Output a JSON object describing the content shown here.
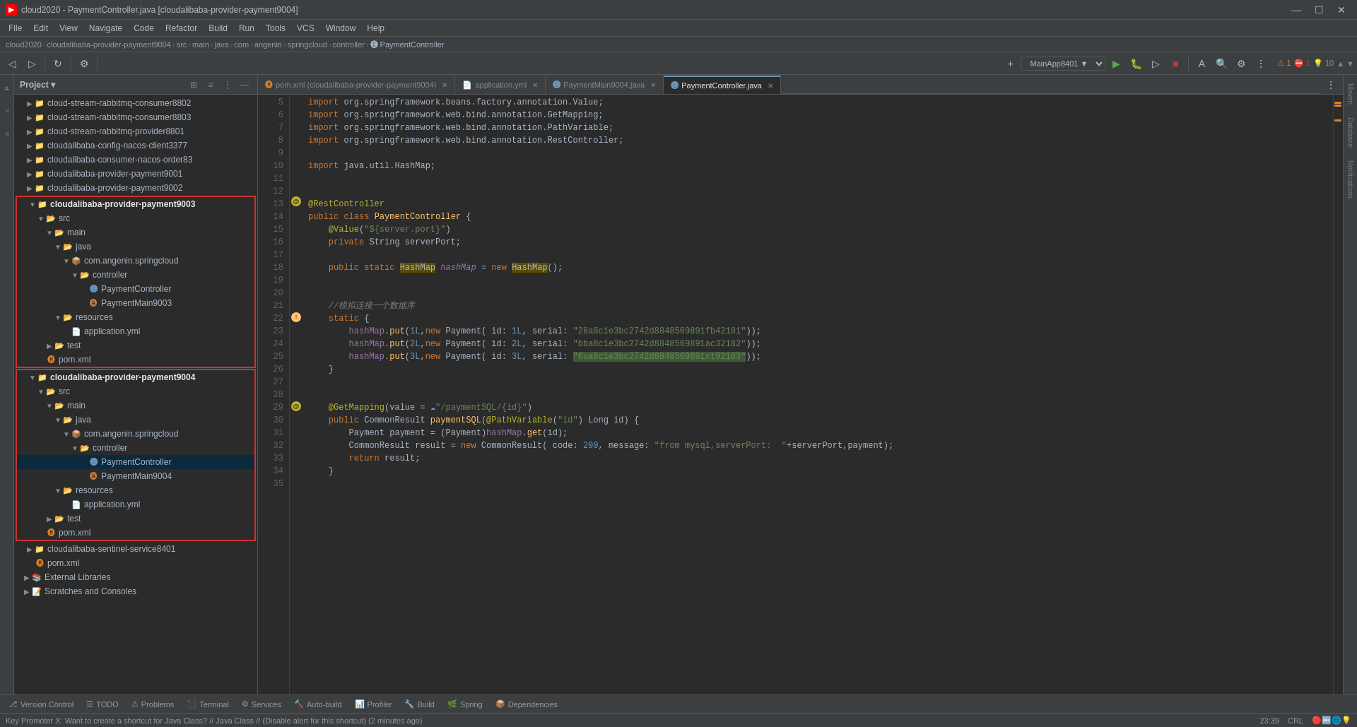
{
  "titleBar": {
    "title": "cloud2020 - PaymentController.java [cloudalibaba-provider-payment9004]",
    "winButtons": [
      "—",
      "☐",
      "✕"
    ]
  },
  "menuBar": {
    "items": [
      "File",
      "Edit",
      "View",
      "Navigate",
      "Code",
      "Refactor",
      "Build",
      "Run",
      "Tools",
      "VCS",
      "Window",
      "Help"
    ]
  },
  "breadcrumb": {
    "items": [
      "cloud2020",
      "cloudalibaba-provider-payment9004",
      "src",
      "main",
      "java",
      "com",
      "angenin",
      "springcloud",
      "controller",
      "PaymentController"
    ]
  },
  "projectPanel": {
    "title": "Project",
    "treeItems": [
      {
        "id": "cloud-stream-rabbitmq-consumer8802",
        "label": "cloud-stream-rabbitmq-consumer8802",
        "level": 1,
        "type": "module",
        "collapsed": true
      },
      {
        "id": "cloud-stream-rabbitmq-consumer8803",
        "label": "cloud-stream-rabbitmq-consumer8803",
        "level": 1,
        "type": "module",
        "collapsed": true
      },
      {
        "id": "cloud-stream-rabbitmq-provider8801",
        "label": "cloud-stream-rabbitmq-provider8801",
        "level": 1,
        "type": "module",
        "collapsed": true
      },
      {
        "id": "cloudalibaba-config-nacos-client3377",
        "label": "cloudalibaba-config-nacos-client3377",
        "level": 1,
        "type": "module",
        "collapsed": true
      },
      {
        "id": "cloudalibaba-consumer-nacos-order83",
        "label": "cloudalibaba-consumer-nacos-order83",
        "level": 1,
        "type": "module",
        "collapsed": true
      },
      {
        "id": "cloudalibaba-provider-payment9001",
        "label": "cloudalibaba-provider-payment9001",
        "level": 1,
        "type": "module",
        "collapsed": true
      },
      {
        "id": "cloudalibaba-provider-payment9002",
        "label": "cloudalibaba-provider-payment9002",
        "level": 1,
        "type": "module",
        "collapsed": true
      },
      {
        "id": "cloudalibaba-provider-payment9003",
        "label": "cloudalibaba-provider-payment9003",
        "level": 1,
        "type": "module",
        "highlighted": true,
        "collapsed": false
      },
      {
        "id": "src-9003",
        "label": "src",
        "level": 2,
        "type": "folder",
        "collapsed": false
      },
      {
        "id": "main-9003",
        "label": "main",
        "level": 3,
        "type": "folder",
        "collapsed": false
      },
      {
        "id": "java-9003",
        "label": "java",
        "level": 4,
        "type": "folder",
        "collapsed": false
      },
      {
        "id": "com-9003",
        "label": "com.angenin.springcloud",
        "level": 5,
        "type": "package",
        "collapsed": false
      },
      {
        "id": "controller-9003",
        "label": "controller",
        "level": 6,
        "type": "folder",
        "collapsed": false
      },
      {
        "id": "PaymentController-9003",
        "label": "PaymentController",
        "level": 7,
        "type": "java-class"
      },
      {
        "id": "PaymentMain9003",
        "label": "PaymentMain9003",
        "level": 7,
        "type": "java-app"
      },
      {
        "id": "resources-9003",
        "label": "resources",
        "level": 4,
        "type": "folder",
        "collapsed": false
      },
      {
        "id": "application-9003",
        "label": "application.yml",
        "level": 5,
        "type": "yml"
      },
      {
        "id": "test-9003",
        "label": "test",
        "level": 3,
        "type": "folder",
        "collapsed": true
      },
      {
        "id": "pom-9003",
        "label": "pom.xml",
        "level": 2,
        "type": "xml"
      },
      {
        "id": "cloudalibaba-provider-payment9004",
        "label": "cloudalibaba-provider-payment9004",
        "level": 1,
        "type": "module",
        "highlighted": true,
        "collapsed": false
      },
      {
        "id": "src-9004",
        "label": "src",
        "level": 2,
        "type": "folder",
        "collapsed": false
      },
      {
        "id": "main-9004",
        "label": "main",
        "level": 3,
        "type": "folder",
        "collapsed": false
      },
      {
        "id": "java-9004",
        "label": "java",
        "level": 4,
        "type": "folder",
        "collapsed": false
      },
      {
        "id": "com-9004",
        "label": "com.angenin.springcloud",
        "level": 5,
        "type": "package",
        "collapsed": false
      },
      {
        "id": "controller-9004",
        "label": "controller",
        "level": 6,
        "type": "folder",
        "collapsed": false
      },
      {
        "id": "PaymentController-9004",
        "label": "PaymentController",
        "level": 7,
        "type": "java-class",
        "selected": true
      },
      {
        "id": "PaymentMain9004",
        "label": "PaymentMain9004",
        "level": 7,
        "type": "java-app"
      },
      {
        "id": "resources-9004",
        "label": "resources",
        "level": 4,
        "type": "folder",
        "collapsed": false
      },
      {
        "id": "application-9004",
        "label": "application.yml",
        "level": 5,
        "type": "yml"
      },
      {
        "id": "test-9004",
        "label": "test",
        "level": 3,
        "type": "folder",
        "collapsed": true
      },
      {
        "id": "pom-9004",
        "label": "pom.xml",
        "level": 2,
        "type": "xml"
      },
      {
        "id": "cloudalibaba-sentinel-service8401",
        "label": "cloudalibaba-sentinel-service8401",
        "level": 1,
        "type": "module",
        "collapsed": true
      },
      {
        "id": "pom-root",
        "label": "pom.xml",
        "level": 1,
        "type": "xml"
      },
      {
        "id": "external-libs",
        "label": "External Libraries",
        "level": 0,
        "type": "folder",
        "collapsed": true
      },
      {
        "id": "scratches",
        "label": "Scratches and Consoles",
        "level": 0,
        "type": "folder",
        "collapsed": true
      }
    ]
  },
  "editorTabs": [
    {
      "id": "pom",
      "label": "pom.xml (cloudalibaba-provider-payment9004)",
      "type": "xml",
      "active": false,
      "modified": true
    },
    {
      "id": "appyml",
      "label": "application.yml",
      "type": "yml",
      "active": false,
      "modified": true
    },
    {
      "id": "main",
      "label": "PaymentMain9004.java",
      "type": "java",
      "active": false,
      "modified": true
    },
    {
      "id": "controller",
      "label": "PaymentController.java",
      "type": "java",
      "active": true,
      "modified": false
    }
  ],
  "codeLines": [
    {
      "num": 5,
      "content": "import org.springframework.beans.factory.annotation.Value;"
    },
    {
      "num": 6,
      "content": "import org.springframework.web.bind.annotation.GetMapping;"
    },
    {
      "num": 7,
      "content": "import org.springframework.web.bind.annotation.PathVariable;"
    },
    {
      "num": 8,
      "content": "import org.springframework.web.bind.annotation.RestController;"
    },
    {
      "num": 9,
      "content": ""
    },
    {
      "num": 10,
      "content": "import java.util.HashMap;"
    },
    {
      "num": 11,
      "content": ""
    },
    {
      "num": 12,
      "content": ""
    },
    {
      "num": 13,
      "content": "@RestController"
    },
    {
      "num": 14,
      "content": "public class PaymentController {"
    },
    {
      "num": 15,
      "content": "    @Value(\"${server.port}\")"
    },
    {
      "num": 16,
      "content": "    private String serverPort;"
    },
    {
      "num": 17,
      "content": ""
    },
    {
      "num": 18,
      "content": "    public static HashMap hashMap = new HashMap();"
    },
    {
      "num": 19,
      "content": ""
    },
    {
      "num": 20,
      "content": ""
    },
    {
      "num": 21,
      "content": "    //模拟连接一个数据库"
    },
    {
      "num": 22,
      "content": "    static {"
    },
    {
      "num": 23,
      "content": "        hashMap.put(1L,new Payment( id: 1L, serial: \"28a8c1e3bc2742d8848569891fb42181\"));"
    },
    {
      "num": 24,
      "content": "        hashMap.put(2L,new Payment( id: 2L, serial: \"bba8c1e3bc2742d8848569891ac32182\"));"
    },
    {
      "num": 25,
      "content": "        hashMap.put(3L,new Payment( id: 3L, serial: \"6ua8c1e3bc2742d8848569891xt92183\"));"
    },
    {
      "num": 26,
      "content": "    }"
    },
    {
      "num": 27,
      "content": ""
    },
    {
      "num": 28,
      "content": ""
    },
    {
      "num": 29,
      "content": "    @GetMapping(value = \"/paymentSQL/{id}\")"
    },
    {
      "num": 30,
      "content": "    public CommonResult paymentSQL(@PathVariable(\"id\") Long id) {"
    },
    {
      "num": 31,
      "content": "        Payment payment = (Payment)hashMap.get(id);"
    },
    {
      "num": 32,
      "content": "        CommonResult result = new CommonResult( code: 200, message: \"from mysql,serverPort:  \"+serverPort,payment);"
    },
    {
      "num": 33,
      "content": "        return result;"
    },
    {
      "num": 34,
      "content": "    }"
    },
    {
      "num": 35,
      "content": ""
    }
  ],
  "bottomTabs": [
    {
      "id": "version-control",
      "label": "Version Control",
      "icon": "⎇"
    },
    {
      "id": "todo",
      "label": "TODO",
      "icon": "☰"
    },
    {
      "id": "problems",
      "label": "Problems",
      "icon": "⚠"
    },
    {
      "id": "terminal",
      "label": "Terminal",
      "icon": ">"
    },
    {
      "id": "services",
      "label": "Services",
      "icon": "⚙"
    },
    {
      "id": "auto-build",
      "label": "Auto-build",
      "icon": "🔨"
    },
    {
      "id": "profiler",
      "label": "Profiler",
      "icon": "📊"
    },
    {
      "id": "build",
      "label": "Build",
      "icon": "🔧"
    },
    {
      "id": "spring",
      "label": "Spring",
      "icon": "🌿"
    },
    {
      "id": "dependencies",
      "label": "Dependencies",
      "icon": "📦"
    }
  ],
  "statusBar": {
    "position": "23:39",
    "encoding": "CRL",
    "gitBranch": "⎇",
    "infoMessage": "Key Promoter X: Want to create a shortcut for Java Class? // Java Class // (Disable alert for this shortcut) (2 minutes ago)"
  },
  "rightPanel": {
    "icons": [
      "Maven",
      "Database",
      "Notifications"
    ]
  },
  "runConfig": "MainApp8401 ▼",
  "warningCount": "1",
  "errorCount": "1",
  "hintCount": "10"
}
